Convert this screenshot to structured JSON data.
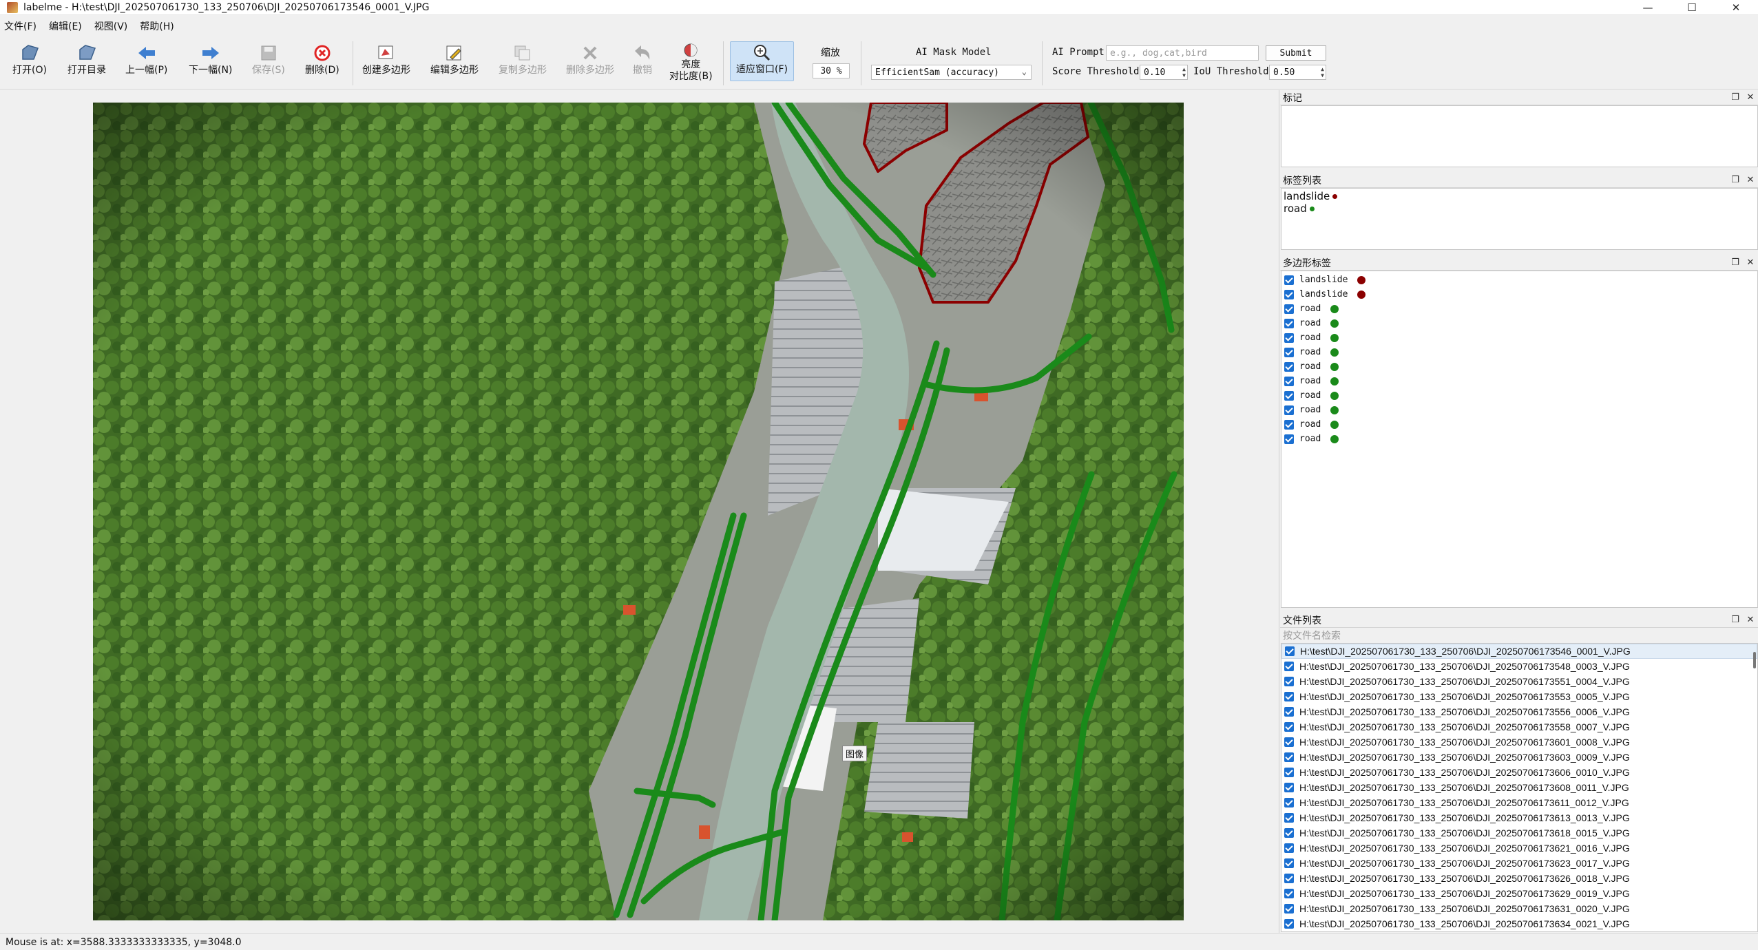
{
  "window": {
    "title": "labelme - H:\\test\\DJI_202507061730_133_250706\\DJI_20250706173546_0001_V.JPG",
    "minimize": "—",
    "maximize": "☐",
    "close": "✕"
  },
  "menu": [
    "文件(F)",
    "编辑(E)",
    "视图(V)",
    "帮助(H)"
  ],
  "toolbar": {
    "open": "打开(O)",
    "open_dir": "打开目录",
    "prev": "上一幅(P)",
    "next": "下一幅(N)",
    "save": "保存(S)",
    "delete": "删除(D)",
    "create_polygon": "创建多边形",
    "edit_polygon": "编辑多边形",
    "copy_polygon": "复制多边形",
    "delete_polygon": "删除多边形",
    "undo": "撤销",
    "brightness_line1": "亮度",
    "brightness_line2": "对比度(B)",
    "fit_window": "适应窗口(F)",
    "zoom_label": "缩放",
    "zoom_value": "30 %",
    "ai_mask_model_label": "AI Mask Model",
    "ai_mask_model_value": "EfficientSam (accuracy)",
    "ai_prompt_label": "AI Prompt",
    "ai_prompt_placeholder": "e.g., dog,cat,bird",
    "submit": "Submit",
    "score_threshold_label": "Score Threshold",
    "score_threshold_value": "0.10",
    "iou_threshold_label": "IoU Threshold",
    "iou_threshold_value": "0.50"
  },
  "canvas": {
    "tooltip": "图像"
  },
  "panels": {
    "flags_title": "标记",
    "label_list_title": "标签列表",
    "polygon_labels_title": "多边形标签",
    "file_list_title": "文件列表",
    "file_search_placeholder": "按文件名检索"
  },
  "label_list": [
    {
      "name": "landslide",
      "color": "#8b0000"
    },
    {
      "name": "road",
      "color": "#1a8a1a"
    }
  ],
  "polygons": [
    {
      "label": "landslide",
      "color": "#8b0000"
    },
    {
      "label": "landslide",
      "color": "#8b0000"
    },
    {
      "label": "road",
      "color": "#1a8a1a"
    },
    {
      "label": "road",
      "color": "#1a8a1a"
    },
    {
      "label": "road",
      "color": "#1a8a1a"
    },
    {
      "label": "road",
      "color": "#1a8a1a"
    },
    {
      "label": "road",
      "color": "#1a8a1a"
    },
    {
      "label": "road",
      "color": "#1a8a1a"
    },
    {
      "label": "road",
      "color": "#1a8a1a"
    },
    {
      "label": "road",
      "color": "#1a8a1a"
    },
    {
      "label": "road",
      "color": "#1a8a1a"
    },
    {
      "label": "road",
      "color": "#1a8a1a"
    }
  ],
  "files": [
    "H:\\test\\DJI_202507061730_133_250706\\DJI_20250706173546_0001_V.JPG",
    "H:\\test\\DJI_202507061730_133_250706\\DJI_20250706173548_0003_V.JPG",
    "H:\\test\\DJI_202507061730_133_250706\\DJI_20250706173551_0004_V.JPG",
    "H:\\test\\DJI_202507061730_133_250706\\DJI_20250706173553_0005_V.JPG",
    "H:\\test\\DJI_202507061730_133_250706\\DJI_20250706173556_0006_V.JPG",
    "H:\\test\\DJI_202507061730_133_250706\\DJI_20250706173558_0007_V.JPG",
    "H:\\test\\DJI_202507061730_133_250706\\DJI_20250706173601_0008_V.JPG",
    "H:\\test\\DJI_202507061730_133_250706\\DJI_20250706173603_0009_V.JPG",
    "H:\\test\\DJI_202507061730_133_250706\\DJI_20250706173606_0010_V.JPG",
    "H:\\test\\DJI_202507061730_133_250706\\DJI_20250706173608_0011_V.JPG",
    "H:\\test\\DJI_202507061730_133_250706\\DJI_20250706173611_0012_V.JPG",
    "H:\\test\\DJI_202507061730_133_250706\\DJI_20250706173613_0013_V.JPG",
    "H:\\test\\DJI_202507061730_133_250706\\DJI_20250706173618_0015_V.JPG",
    "H:\\test\\DJI_202507061730_133_250706\\DJI_20250706173621_0016_V.JPG",
    "H:\\test\\DJI_202507061730_133_250706\\DJI_20250706173623_0017_V.JPG",
    "H:\\test\\DJI_202507061730_133_250706\\DJI_20250706173626_0018_V.JPG",
    "H:\\test\\DJI_202507061730_133_250706\\DJI_20250706173629_0019_V.JPG",
    "H:\\test\\DJI_202507061730_133_250706\\DJI_20250706173631_0020_V.JPG",
    "H:\\test\\DJI_202507061730_133_250706\\DJI_20250706173634_0021_V.JPG"
  ],
  "status": "Mouse is at: x=3588.3333333333335, y=3048.0"
}
